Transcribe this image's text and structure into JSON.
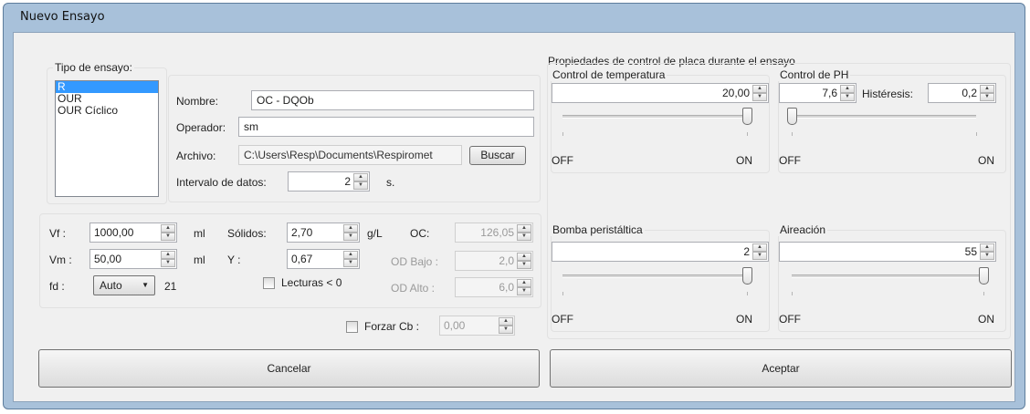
{
  "window": {
    "title": "Nuevo Ensayo"
  },
  "tipo": {
    "legend": "Tipo de ensayo:",
    "items": [
      "R",
      "OUR",
      "OUR Cíclico"
    ],
    "selected": "R"
  },
  "info": {
    "nombre_label": "Nombre:",
    "nombre_value": "OC - DQOb",
    "operador_label": "Operador:",
    "operador_value": "sm",
    "archivo_label": "Archivo:",
    "archivo_value": "C:\\Users\\Resp\\Documents\\Respiromet",
    "buscar_label": "Buscar",
    "intervalo_label": "Intervalo de datos:",
    "intervalo_value": "2",
    "intervalo_unit": "s."
  },
  "params": {
    "vf_label": "Vf :",
    "vf_value": "1000,00",
    "vf_unit": "ml",
    "vm_label": "Vm :",
    "vm_value": "50,00",
    "vm_unit": "ml",
    "fd_label": "fd :",
    "fd_value": "Auto",
    "fd_number": "21",
    "solidos_label": "Sólidos:",
    "solidos_value": "2,70",
    "solidos_unit": "g/L",
    "y_label": "Y :",
    "y_value": "0,67",
    "oc_label": "OC:",
    "oc_value": "126,05",
    "odbajo_label": "OD Bajo :",
    "odbajo_value": "2,0",
    "odalto_label": "OD Alto :",
    "odalto_value": "6,0",
    "lecturas_label": "Lecturas < 0"
  },
  "forzar": {
    "label": "Forzar Cb :",
    "value": "0,00"
  },
  "control": {
    "legend": "Propiedades de control de placa durante el ensayo",
    "temperatura": {
      "legend": "Control de temperatura",
      "value": "20,00",
      "off": "OFF",
      "on": "ON",
      "level": 1.0
    },
    "ph": {
      "legend": "Control de PH",
      "value": "7,6",
      "histeresis_label": "Histéresis:",
      "histeresis_value": "0,2",
      "off": "OFF",
      "on": "ON",
      "level": 0.0
    },
    "bomba": {
      "legend": "Bomba peristáltica",
      "value": "2",
      "off": "OFF",
      "on": "ON",
      "level": 1.0
    },
    "aireacion": {
      "legend": "Aireación",
      "value": "55",
      "off": "OFF",
      "on": "ON",
      "level": 1.0
    }
  },
  "buttons": {
    "cancel": "Cancelar",
    "accept": "Aceptar"
  },
  "icons": {
    "spin_up": "spin-up-arrow-icon",
    "spin_down": "spin-down-arrow-icon",
    "dropdown": "chevron-down-icon"
  }
}
